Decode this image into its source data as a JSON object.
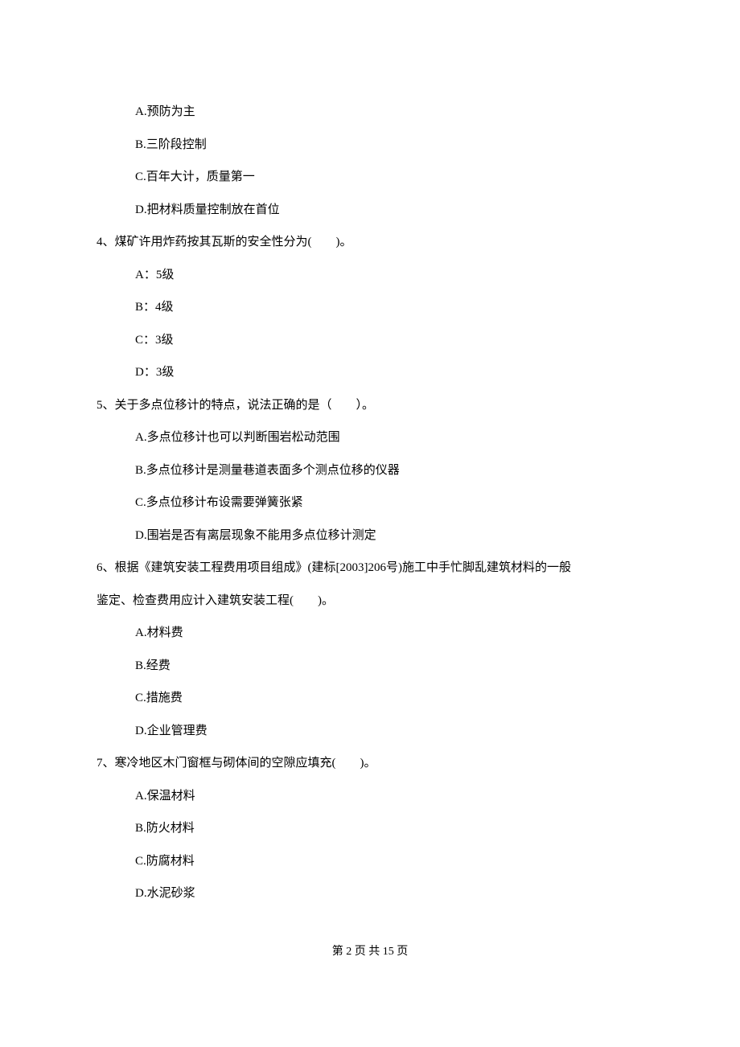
{
  "q3": {
    "options": {
      "A": "A.预防为主",
      "B": "B.三阶段控制",
      "C": "C.百年大计，质量第一",
      "D": "D.把材料质量控制放在首位"
    }
  },
  "q4": {
    "stem": "4、煤矿许用炸药按其瓦斯的安全性分为(　　)。",
    "options": {
      "A": "A：5级",
      "B": "B：4级",
      "C": "C：3级",
      "D": "D：3级"
    }
  },
  "q5": {
    "stem": "5、关于多点位移计的特点，说法正确的是（　　）。",
    "options": {
      "A": "A.多点位移计也可以判断围岩松动范围",
      "B": "B.多点位移计是测量巷道表面多个测点位移的仪器",
      "C": "C.多点位移计布设需要弹簧张紧",
      "D": "D.围岩是否有离层现象不能用多点位移计测定"
    }
  },
  "q6": {
    "stem_line1": "6、根据《建筑安装工程费用项目组成》(建标[2003]206号)施工中手忙脚乱建筑材料的一般",
    "stem_line2": "鉴定、检查费用应计入建筑安装工程(　　)。",
    "options": {
      "A": "A.材料费",
      "B": "B.经费",
      "C": "C.措施费",
      "D": "D.企业管理费"
    }
  },
  "q7": {
    "stem": "7、寒冷地区木门窗框与砌体间的空隙应填充(　　)。",
    "options": {
      "A": "A.保温材料",
      "B": "B.防火材料",
      "C": "C.防腐材料",
      "D": "D.水泥砂浆"
    }
  },
  "footer": "第 2 页 共 15 页"
}
